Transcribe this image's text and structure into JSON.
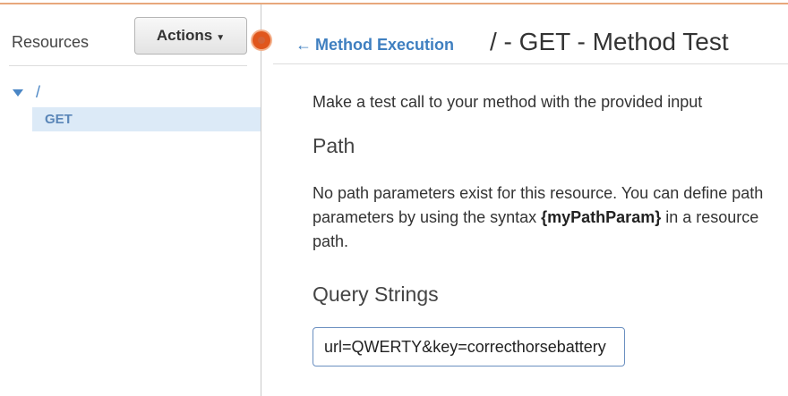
{
  "sidebar": {
    "title": "Resources",
    "actions_label": "Actions",
    "tree": {
      "root_label": "/",
      "items": [
        {
          "label": "GET",
          "selected": true
        }
      ]
    }
  },
  "header": {
    "back_link_label": "Method Execution",
    "title": "/ - GET - Method Test"
  },
  "main": {
    "intro": "Make a test call to your method with the provided input",
    "path": {
      "heading": "Path",
      "desc_before": "No path parameters exist for this resource. You can define path parameters by using the syntax ",
      "desc_bold": "{myPathParam}",
      "desc_after": " in a resource path."
    },
    "query_strings": {
      "heading": "Query Strings",
      "value": "url=QWERTY&key=correcthorsebattery"
    }
  },
  "colors": {
    "link": "#3f7fc0",
    "selected_bg": "#dceaf7",
    "handle": "#e0561c"
  }
}
